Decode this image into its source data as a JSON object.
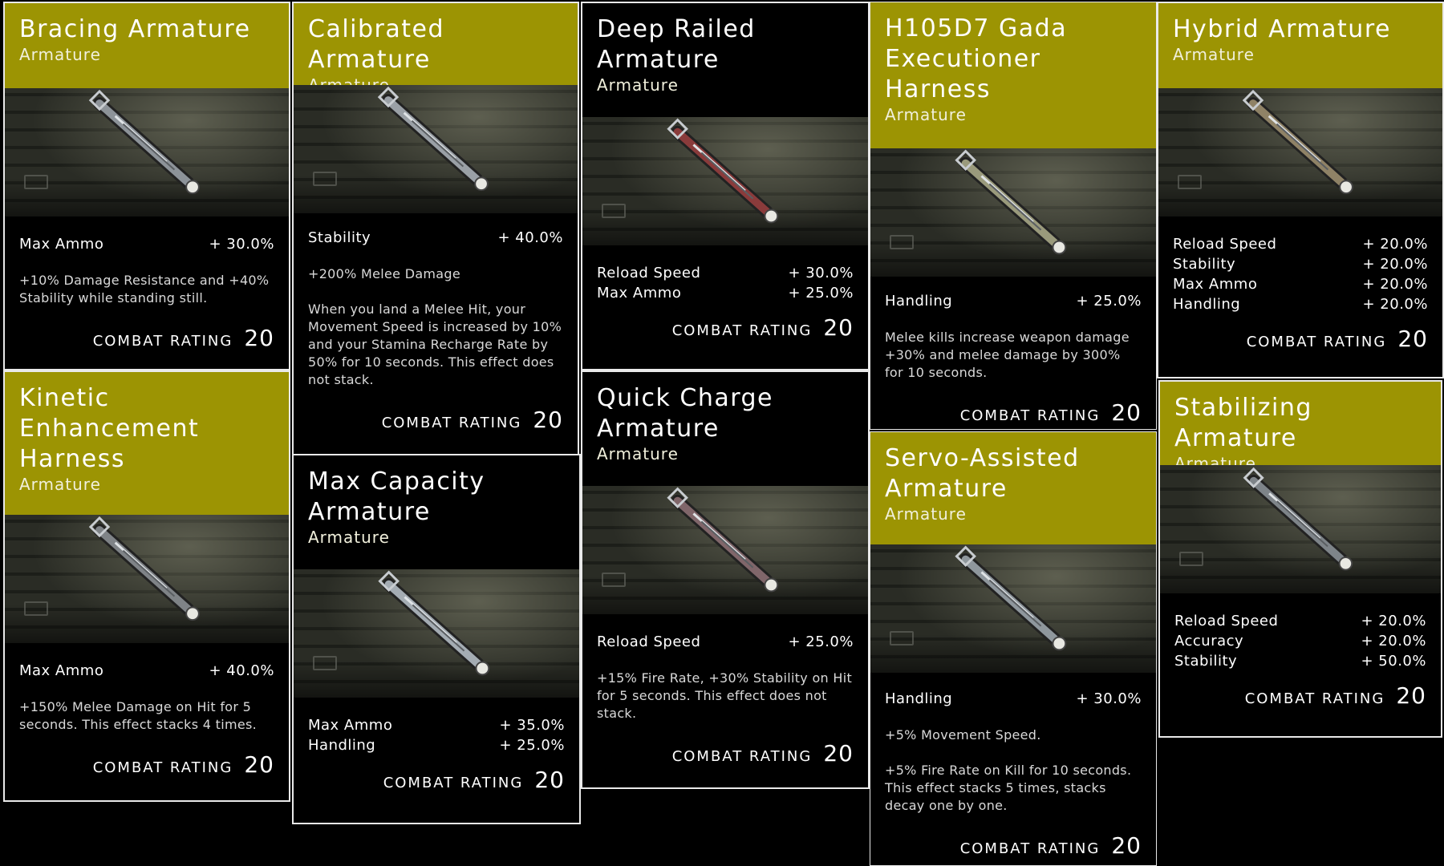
{
  "colors": {
    "gold_header": "#9c9403",
    "card_bg": "#000000",
    "border": "#e9e9e9"
  },
  "cards": [
    {
      "title": "Bracing Armature",
      "subtitle": "Armature",
      "stats": [
        {
          "label": "Max Ammo",
          "value": "+ 30.0%"
        }
      ],
      "desc": [
        "+10% Damage Resistance and +40% Stability while standing still."
      ],
      "rating_label": "COMBAT RATING",
      "rating": "20",
      "item_color": "#8d9399"
    },
    {
      "title": "Calibrated Armature",
      "subtitle": "Armature",
      "stats": [
        {
          "label": "Stability",
          "value": "+ 40.0%"
        }
      ],
      "desc": [
        "+200% Melee Damage",
        "When you land a Melee Hit, your Movement Speed is increased by 10% and your Stamina Recharge Rate by 50% for 10 seconds. This effect does not stack."
      ],
      "rating_label": "COMBAT RATING",
      "rating": "20",
      "item_color": "#9aa0a6"
    },
    {
      "title": "Deep Railed\nArmature",
      "subtitle": "Armature",
      "stats": [
        {
          "label": "Reload Speed",
          "value": "+ 30.0%"
        },
        {
          "label": "Max Ammo",
          "value": "+ 25.0%"
        }
      ],
      "desc": [],
      "rating_label": "COMBAT RATING",
      "rating": "20",
      "item_color": "#8a3b3b"
    },
    {
      "title": "H105D7 Gada\nExecutioner\nHarness",
      "subtitle": "Armature",
      "stats": [
        {
          "label": "Handling",
          "value": "+ 25.0%"
        }
      ],
      "desc": [
        "Melee kills increase weapon damage +30% and melee damage by 300% for 10 seconds."
      ],
      "rating_label": "COMBAT RATING",
      "rating": "20",
      "item_color": "#9a9a7c"
    },
    {
      "title": "Hybrid Armature",
      "subtitle": "Armature",
      "stats": [
        {
          "label": "Reload Speed",
          "value": "+ 20.0%"
        },
        {
          "label": "Stability",
          "value": "+ 20.0%"
        },
        {
          "label": "Max Ammo",
          "value": "+ 20.0%"
        },
        {
          "label": "Handling",
          "value": "+ 20.0%"
        }
      ],
      "desc": [],
      "rating_label": "COMBAT RATING",
      "rating": "20",
      "item_color": "#8f8266"
    },
    {
      "title": "Kinetic\nEnhancement\nHarness",
      "subtitle": "Armature",
      "stats": [
        {
          "label": "Max Ammo",
          "value": "+ 40.0%"
        }
      ],
      "desc": [
        "+150% Melee Damage on Hit for 5 seconds. This effect stacks 4 times."
      ],
      "rating_label": "COMBAT RATING",
      "rating": "20",
      "item_color": "#7f8387"
    },
    {
      "title": "Max Capacity\nArmature",
      "subtitle": "Armature",
      "stats": [
        {
          "label": "Max Ammo",
          "value": "+ 35.0%"
        },
        {
          "label": "Handling",
          "value": "+ 25.0%"
        }
      ],
      "desc": [],
      "rating_label": "COMBAT RATING",
      "rating": "20",
      "item_color": "#a4acb3"
    },
    {
      "title": "Quick Charge\nArmature",
      "subtitle": "Armature",
      "stats": [
        {
          "label": "Reload Speed",
          "value": "+ 25.0%"
        }
      ],
      "desc": [
        "+15% Fire Rate, +30% Stability on Hit for 5 seconds. This effect does not stack."
      ],
      "rating_label": "COMBAT RATING",
      "rating": "20",
      "item_color": "#80666a"
    },
    {
      "title": "Servo-Assisted\nArmature",
      "subtitle": "Armature",
      "stats": [
        {
          "label": "Handling",
          "value": "+ 30.0%"
        }
      ],
      "desc": [
        "+5% Movement Speed.",
        "+5% Fire Rate on Kill for 10 seconds. This effect stacks 5 times, stacks decay one by one."
      ],
      "rating_label": "COMBAT RATING",
      "rating": "20",
      "item_color": "#8f979d"
    },
    {
      "title": "Stabilizing Armature",
      "subtitle": "Armature",
      "stats": [
        {
          "label": "Reload Speed",
          "value": "+ 20.0%"
        },
        {
          "label": "Accuracy",
          "value": "+ 20.0%"
        },
        {
          "label": "Stability",
          "value": "+ 50.0%"
        }
      ],
      "desc": [],
      "rating_label": "COMBAT RATING",
      "rating": "20",
      "item_color": "#7e8489"
    }
  ]
}
